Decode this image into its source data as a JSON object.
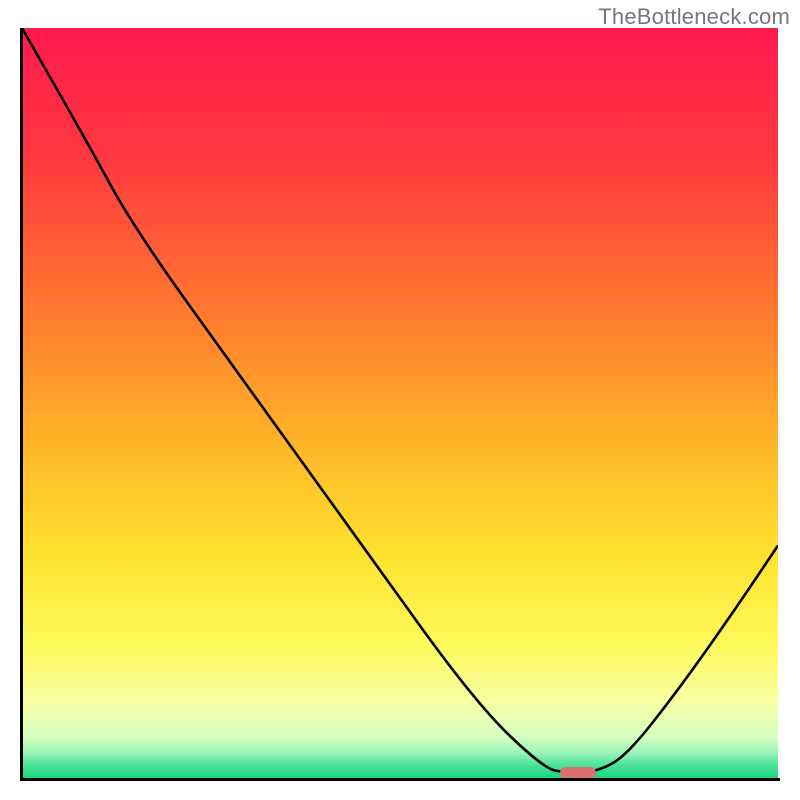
{
  "watermark": "TheBottleneck.com",
  "colors": {
    "gradient_stops": [
      {
        "offset": 0.0,
        "color": "#ff1a4f"
      },
      {
        "offset": 0.18,
        "color": "#ff3a3f"
      },
      {
        "offset": 0.38,
        "color": "#ff7a2f"
      },
      {
        "offset": 0.55,
        "color": "#ffb428"
      },
      {
        "offset": 0.7,
        "color": "#ffe12e"
      },
      {
        "offset": 0.82,
        "color": "#fff95a"
      },
      {
        "offset": 0.9,
        "color": "#f6ffa4"
      },
      {
        "offset": 0.945,
        "color": "#d6ffc0"
      },
      {
        "offset": 0.965,
        "color": "#9ff5b8"
      },
      {
        "offset": 0.982,
        "color": "#4ee39a"
      },
      {
        "offset": 1.0,
        "color": "#17d67f"
      }
    ],
    "curve": "#000000",
    "marker": "#d96f6f",
    "axis": "#000000"
  },
  "chart_data": {
    "type": "line",
    "title": "",
    "xlabel": "",
    "ylabel": "",
    "xlim": [
      0,
      1
    ],
    "ylim": [
      0,
      1
    ],
    "series": [
      {
        "name": "bottleneck-curve",
        "points": [
          {
            "x": 0.0,
            "y": 1.0
          },
          {
            "x": 0.085,
            "y": 0.85
          },
          {
            "x": 0.15,
            "y": 0.73
          },
          {
            "x": 0.3,
            "y": 0.52
          },
          {
            "x": 0.45,
            "y": 0.31
          },
          {
            "x": 0.6,
            "y": 0.1
          },
          {
            "x": 0.69,
            "y": 0.013
          },
          {
            "x": 0.72,
            "y": 0.007
          },
          {
            "x": 0.76,
            "y": 0.008
          },
          {
            "x": 0.8,
            "y": 0.03
          },
          {
            "x": 0.87,
            "y": 0.12
          },
          {
            "x": 0.94,
            "y": 0.22
          },
          {
            "x": 1.0,
            "y": 0.31
          }
        ]
      }
    ],
    "marker": {
      "x": 0.735,
      "y": 0.007
    },
    "grid": false,
    "legend": false
  }
}
